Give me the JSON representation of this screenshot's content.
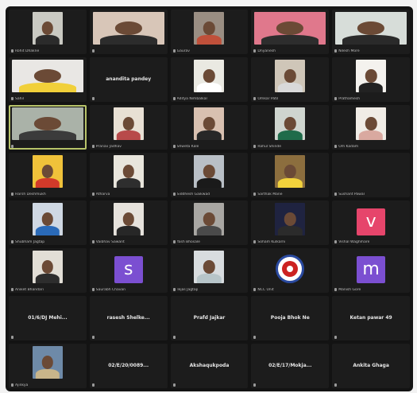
{
  "meeting": {
    "tiles": [
      {
        "type": "video",
        "bg": "#c9c9c2",
        "body": "#2b2b2b",
        "label": "Rohit Dhakne"
      },
      {
        "type": "video",
        "bg": "#d8c6b8",
        "body": "#2c2c2c",
        "wide": true,
        "label": ""
      },
      {
        "type": "video",
        "bg": "#9a8e83",
        "body": "#c0503a",
        "label": "Gaurav"
      },
      {
        "type": "video",
        "bg": "#e0788c",
        "body": "#2d2d2d",
        "wide": true,
        "label": "Dnyanesh"
      },
      {
        "type": "video",
        "bg": "#d7ddd9",
        "body": "#2a2a2a",
        "wide": true,
        "label": "Nilesh More"
      },
      {
        "type": "video",
        "bg": "#e9e7e4",
        "body": "#f1d03a",
        "wide": true,
        "label": "Sahil"
      },
      {
        "type": "name",
        "name": "anandita pandey",
        "label": ""
      },
      {
        "type": "video",
        "bg": "#eae9e2",
        "body": "#ffffff",
        "label": "Aditya Nimbalkar"
      },
      {
        "type": "video",
        "bg": "#cfc6b8",
        "body": "#d9d9d9",
        "label": "Omkar Patil"
      },
      {
        "type": "video",
        "bg": "#f4f2ee",
        "body": "#222222",
        "label": "Prathamesh"
      },
      {
        "type": "video",
        "bg": "#aab2a8",
        "body": "#3b3b3b",
        "wide": true,
        "active": true,
        "label": ""
      },
      {
        "type": "video",
        "bg": "#e8e0d4",
        "body": "#b84a4a",
        "label": "Pranav Jadhav"
      },
      {
        "type": "video",
        "bg": "#d8c0b0",
        "body": "#272727",
        "label": "Shweta Kale"
      },
      {
        "type": "video",
        "bg": "#cfd5cf",
        "body": "#1f6b4a",
        "label": "Rahul Shinde"
      },
      {
        "type": "video",
        "bg": "#f0ece6",
        "body": "#d9a9a0",
        "label": "Om Kadam"
      },
      {
        "type": "video",
        "bg": "#f0c23a",
        "body": "#d23a2a",
        "label": "Harsh Deshmukh"
      },
      {
        "type": "video",
        "bg": "#e8e5dc",
        "body": "#2e2e2e",
        "label": "Atharva"
      },
      {
        "type": "video",
        "bg": "#b9bfc6",
        "body": "#1a1a1a",
        "label": "Siddhesh Gaikwad"
      },
      {
        "type": "video",
        "bg": "#8c6e3e",
        "body": "#f2d23c",
        "label": "Sarthak Mane"
      },
      {
        "type": "blank",
        "label": "Sushant Pawar"
      },
      {
        "type": "video",
        "bg": "#cfd8e3",
        "body": "#2a6ab8",
        "label": "Shubham Jagtap"
      },
      {
        "type": "video",
        "bg": "#e6e2dc",
        "body": "#272727",
        "label": "Vaibhav Sawant"
      },
      {
        "type": "video",
        "bg": "#a9a7a3",
        "body": "#4a4a4a",
        "label": "Yash Bhosale"
      },
      {
        "type": "video",
        "bg": "#1f2340",
        "body": "#2b2b2b",
        "label": "Soham Kulkarni"
      },
      {
        "type": "avatar",
        "letter": "v",
        "color": "#e6456b",
        "label": "Vishal Waghmare"
      },
      {
        "type": "video",
        "bg": "#e2ded6",
        "body": "#2d2d2d",
        "label": "Aniket Bhandari"
      },
      {
        "type": "avatar",
        "letter": "s",
        "color": "#7b4fd1",
        "label": "Saurabh Chavan"
      },
      {
        "type": "video",
        "bg": "#d8dcdf",
        "body": "#b7c5c9",
        "label": "Tejas Jagtap"
      },
      {
        "type": "logo",
        "label": "NCC Unit"
      },
      {
        "type": "avatar",
        "letter": "m",
        "color": "#7b4fd1",
        "label": "Manish Gore"
      },
      {
        "type": "name",
        "name": "01/6/DJ  Mehi...",
        "label": ""
      },
      {
        "type": "name",
        "name": "rasesh  Shelke...",
        "label": ""
      },
      {
        "type": "name",
        "name": "Prafd  Jajkar",
        "label": ""
      },
      {
        "type": "name",
        "name": "Pooja Bhok Ne",
        "label": ""
      },
      {
        "type": "name",
        "name": "Ketan pawar 49",
        "label": ""
      },
      {
        "type": "video",
        "bg": "#6e8aa8",
        "body": "#c9b58a",
        "label": "Ajinkya"
      },
      {
        "type": "name",
        "name": "02/E/20/0089...",
        "label": ""
      },
      {
        "type": "name",
        "name": "Akshaqukpoda",
        "label": ""
      },
      {
        "type": "name",
        "name": "02/E/17/Mokja...",
        "label": ""
      },
      {
        "type": "name",
        "name": "Ankita Ghaga",
        "label": ""
      }
    ]
  }
}
